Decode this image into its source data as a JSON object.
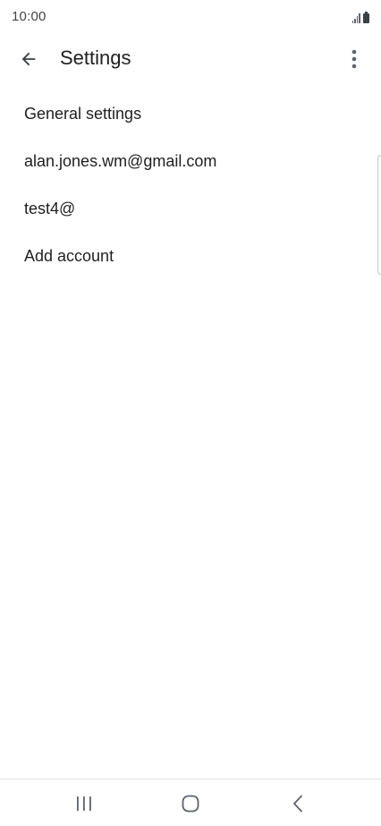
{
  "status_bar": {
    "time": "10:00",
    "icons": [
      "signal-icon",
      "battery-icon"
    ]
  },
  "app_bar": {
    "back_icon": "arrow-back-icon",
    "title": "Settings",
    "overflow_icon": "more-vert-icon"
  },
  "settings": {
    "items": [
      {
        "label": "General settings"
      },
      {
        "label": "alan.jones.wm@gmail.com"
      },
      {
        "label": "test4@"
      },
      {
        "label": "Add account"
      }
    ]
  },
  "nav_bar": {
    "icons": [
      "recents-icon",
      "home-icon",
      "back-icon"
    ]
  },
  "colors": {
    "text": "#1f1f1f",
    "icon": "#5f6368",
    "background": "#ffffff"
  }
}
